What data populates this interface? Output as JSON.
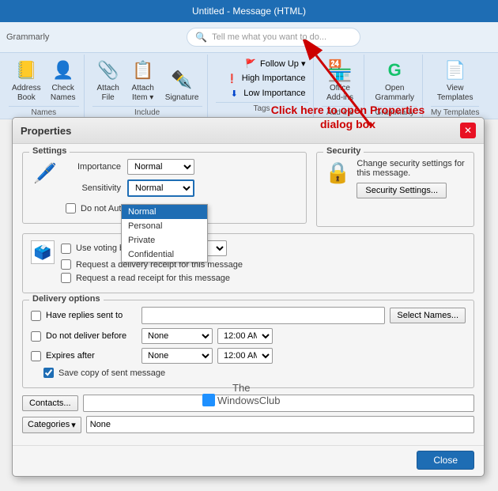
{
  "titlebar": {
    "text": "Untitled - Message (HTML)"
  },
  "ribbon": {
    "search_placeholder": "Tell me what you want to do...",
    "tabs": [
      "Grammarly"
    ],
    "groups": [
      {
        "name": "Names",
        "items": [
          {
            "id": "address-book",
            "icon": "📒",
            "label": "Address\nBook"
          },
          {
            "id": "check-names",
            "icon": "👤",
            "label": "Check\nNames"
          }
        ]
      },
      {
        "name": "Include",
        "items": [
          {
            "id": "attach-file",
            "icon": "📎",
            "label": "Attach\nFile"
          },
          {
            "id": "attach-item",
            "icon": "📋",
            "label": "Attach\nItem"
          },
          {
            "id": "signature",
            "icon": "✒️",
            "label": "Signature"
          }
        ]
      },
      {
        "name": "Tags",
        "items": [
          {
            "id": "follow-up",
            "icon": "🚩",
            "label": "Follow Up"
          },
          {
            "id": "high-importance",
            "icon": "❗",
            "label": "High Importance"
          },
          {
            "id": "low-importance",
            "icon": "⬇",
            "label": "Low Importance"
          }
        ]
      },
      {
        "name": "Add-ins",
        "items": [
          {
            "id": "office-addins",
            "icon": "🏪",
            "label": "Office\nAdd-ins"
          }
        ]
      },
      {
        "name": "Grammarly",
        "items": [
          {
            "id": "open-grammarly",
            "icon": "G",
            "label": "Open\nGrammarly"
          }
        ]
      },
      {
        "name": "My Templates",
        "items": [
          {
            "id": "view-templates",
            "icon": "📄",
            "label": "View\nTemplates"
          }
        ]
      }
    ]
  },
  "dialog": {
    "title": "Properties",
    "close_label": "✕",
    "sections": {
      "settings": {
        "label": "Settings",
        "importance_label": "Importance",
        "importance_value": "Normal",
        "sensitivity_label": "Sensitivity",
        "sensitivity_value": "Normal",
        "do_not_autoarchive_label": "Do not AutoArchive this item"
      },
      "security": {
        "label": "Security",
        "description": "Change security settings for this message.",
        "button_label": "Security Settings..."
      }
    },
    "voting": {
      "use_voting_label": "Use voting buttons",
      "delivery_receipt_label": "Request a delivery receipt for this message",
      "read_receipt_label": "Request a read receipt for this message"
    },
    "delivery": {
      "label": "Delivery options",
      "have_replies_label": "Have replies sent to",
      "replies_input": "",
      "select_names_btn": "Select Names...",
      "do_not_deliver_label": "Do not deliver before",
      "do_not_deliver_date": "None",
      "do_not_deliver_time": "12:00 AM",
      "expires_label": "Expires after",
      "expires_date": "None",
      "expires_time": "12:00 AM",
      "save_copy_label": "Save copy of sent message"
    },
    "footer": {
      "contacts_btn": "Contacts...",
      "categories_btn": "Categories",
      "categories_value": "None",
      "close_btn": "Close"
    }
  },
  "dropdown": {
    "items": [
      "Normal",
      "Personal",
      "Private",
      "Confidential"
    ],
    "selected": "Normal"
  },
  "annotation": {
    "text": "Click here to open Properties\ndialog box"
  },
  "watermark": {
    "line1": "The",
    "line2": "WindowsClub"
  }
}
